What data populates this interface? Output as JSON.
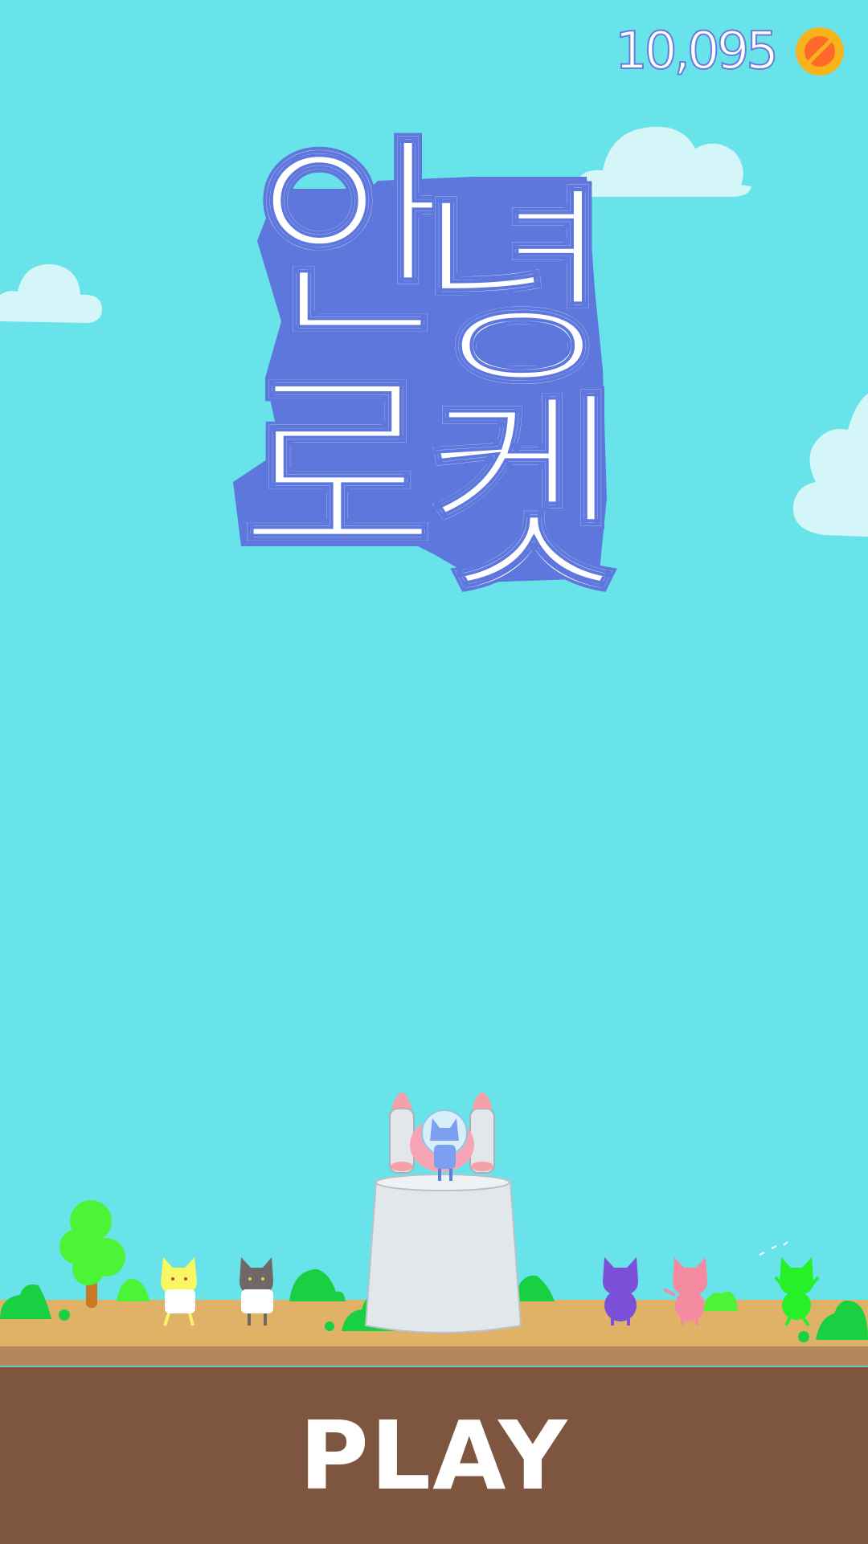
{
  "header": {
    "coin_count": "10,095",
    "coin_icon": "coin-icon"
  },
  "title": {
    "line1_char1": "안",
    "line1_char2": "녕",
    "line2_char1": "로",
    "line2_char2": "켓"
  },
  "play_button": {
    "label": "PLAY"
  },
  "colors": {
    "sky": "#68e3e9",
    "title_shadow": "#5e77dc",
    "title_fill": "#ffffff",
    "ground": "#dfb268",
    "panel": "#7e5640",
    "coin": "#f7b21c"
  },
  "characters": [
    "yellow-cat-scientist",
    "gray-cat-scientist",
    "blue-cat-astronaut",
    "purple-cat",
    "pink-cat",
    "green-cat"
  ]
}
